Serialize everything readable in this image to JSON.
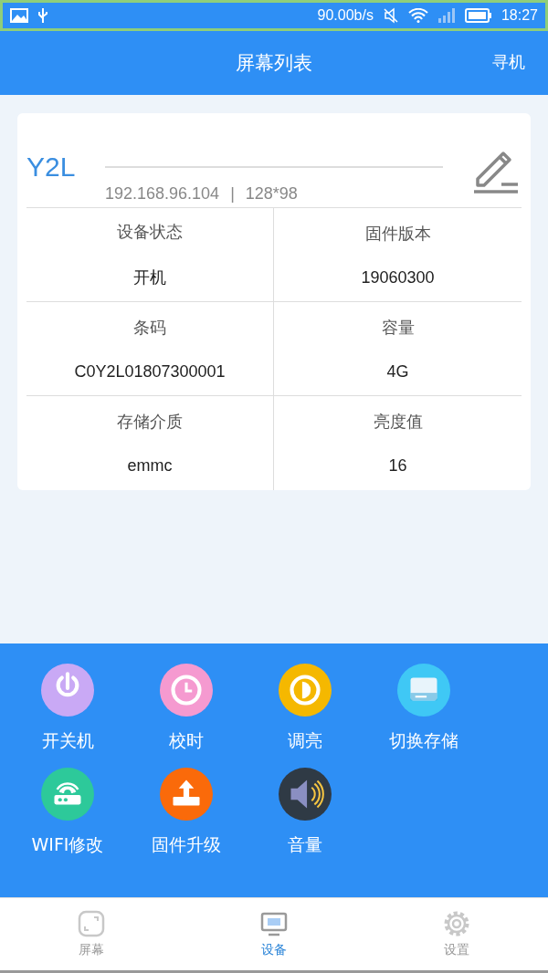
{
  "status_bar": {
    "speed": "90.00b/s",
    "time": "18:27"
  },
  "header": {
    "title": "屏幕列表",
    "action": "寻机"
  },
  "device": {
    "name": "Y2L",
    "ip": "192.168.96.104",
    "separator": "|",
    "resolution": "128*98",
    "info": [
      {
        "label": "设备状态",
        "value": "开机"
      },
      {
        "label": "固件版本",
        "value": "19060300"
      },
      {
        "label": "条码",
        "value": "C0Y2L01807300001"
      },
      {
        "label": "容量",
        "value": "4G"
      },
      {
        "label": "存储介质",
        "value": "emmc"
      },
      {
        "label": "亮度值",
        "value": "16"
      }
    ]
  },
  "actions": [
    {
      "kind": "power",
      "label": "开关机",
      "color": "#c9a9f5"
    },
    {
      "kind": "clock",
      "label": "校时",
      "color": "#f59ad0"
    },
    {
      "kind": "brightness",
      "label": "调亮",
      "color": "#f5b800"
    },
    {
      "kind": "storage",
      "label": "切换存储",
      "color": "#3fc8f5"
    },
    {
      "kind": "wifi",
      "label": "WIFI修改",
      "color": "#2dc99a"
    },
    {
      "kind": "upgrade",
      "label": "固件升级",
      "color": "#fa6a0a"
    },
    {
      "kind": "volume",
      "label": "音量",
      "color": "#2f3a45"
    }
  ],
  "tabs": [
    {
      "kind": "screen",
      "label": "屏幕",
      "selected": false
    },
    {
      "kind": "device",
      "label": "设备",
      "selected": true
    },
    {
      "kind": "settings",
      "label": "设置",
      "selected": false
    }
  ]
}
